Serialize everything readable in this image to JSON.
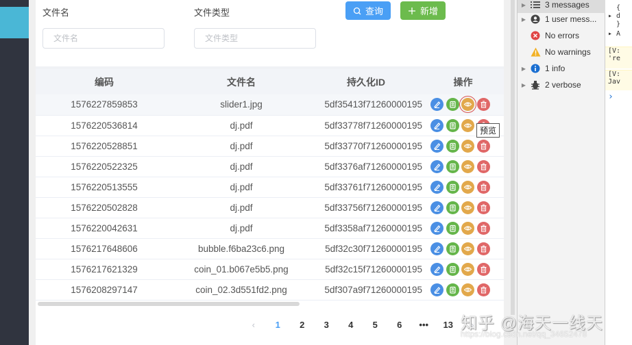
{
  "search": {
    "filename_label": "文件名",
    "filename_placeholder": "文件名",
    "filetype_label": "文件类型",
    "filetype_placeholder": "文件类型",
    "query_label": "查询",
    "add_label": "新增"
  },
  "table": {
    "columns": [
      "编码",
      "文件名",
      "持久化ID",
      "操作"
    ],
    "rows": [
      {
        "code": "1576227859853",
        "name": "slider1.jpg",
        "pid": "5df35413f71260000195"
      },
      {
        "code": "1576220536814",
        "name": "dj.pdf",
        "pid": "5df33778f71260000195"
      },
      {
        "code": "1576220528851",
        "name": "dj.pdf",
        "pid": "5df33770f71260000195"
      },
      {
        "code": "1576220522325",
        "name": "dj.pdf",
        "pid": "5df3376af71260000195"
      },
      {
        "code": "1576220513555",
        "name": "dj.pdf",
        "pid": "5df33761f71260000195"
      },
      {
        "code": "1576220502828",
        "name": "dj.pdf",
        "pid": "5df33756f71260000195"
      },
      {
        "code": "1576220042631",
        "name": "dj.pdf",
        "pid": "5df3358af71260000195"
      },
      {
        "code": "1576217648606",
        "name": "bubble.f6ba23c6.png",
        "pid": "5df32c30f71260000195"
      },
      {
        "code": "1576217621329",
        "name": "coin_01.b067e5b5.png",
        "pid": "5df32c15f71260000195"
      },
      {
        "code": "1576208297147",
        "name": "coin_02.3d551fd2.png",
        "pid": "5df307a9f71260000195"
      }
    ],
    "actions": [
      "edit-icon",
      "download-icon",
      "eye-icon",
      "trash-icon"
    ],
    "tooltip": "预览"
  },
  "pagination": {
    "prev": "‹",
    "pages": [
      "1",
      "2",
      "3",
      "4",
      "5",
      "6",
      "•••",
      "13"
    ],
    "current": "1",
    "next": "›"
  },
  "devtools": {
    "items": [
      {
        "label": "3 messages",
        "icon": "list-icon",
        "expandable": true
      },
      {
        "label": "1 user mess...",
        "icon": "user-icon",
        "expandable": true
      },
      {
        "label": "No errors",
        "icon": "error-icon",
        "expandable": false
      },
      {
        "label": "No warnings",
        "icon": "warning-icon",
        "expandable": false
      },
      {
        "label": "1 info",
        "icon": "info-icon",
        "expandable": true
      },
      {
        "label": "2 verbose",
        "icon": "bug-icon",
        "expandable": true
      }
    ],
    "console_lines": [
      "  {",
      "▸ d",
      "  }",
      "▸ A",
      "[V:\n're",
      "[V:\nJav",
      "›"
    ]
  },
  "watermark": {
    "line1": "知乎 @海天一线天",
    "line2": "https://blog.csdn.net/qq_34652478"
  },
  "colors": {
    "primary": "#4a9ff5",
    "success": "#6cbb4d",
    "edit": "#4a8fe4",
    "download": "#65b54a",
    "view": "#e2a84b",
    "delete": "#e06767",
    "sidebar": "#30343f",
    "sidebar_active": "#4ab7d6"
  }
}
